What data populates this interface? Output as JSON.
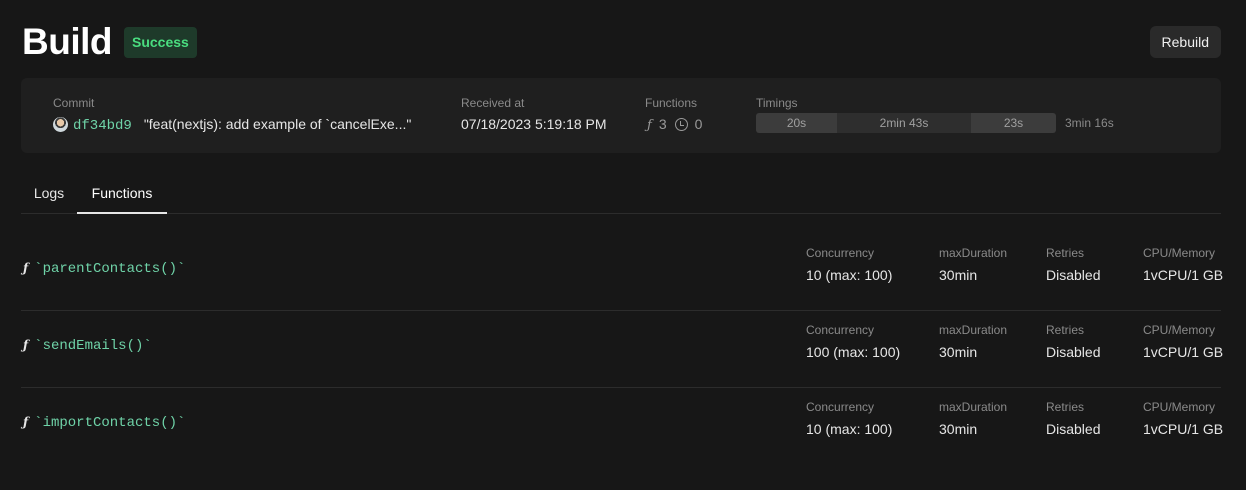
{
  "header": {
    "title": "Build",
    "status": "Success",
    "rebuild_label": "Rebuild"
  },
  "summary": {
    "commit_label": "Commit",
    "commit_hash": "df34bd9",
    "commit_message": "\"feat(nextjs): add example of `cancelExe...\"",
    "received_label": "Received at",
    "received_value": "07/18/2023 5:19:18 PM",
    "functions_label": "Functions",
    "functions_count": "3",
    "scheduled_count": "0",
    "timings_label": "Timings",
    "timings": [
      "20s",
      "2min 43s",
      "23s"
    ],
    "timings_total": "3min 16s"
  },
  "tabs": [
    {
      "label": "Logs",
      "active": false
    },
    {
      "label": "Functions",
      "active": true
    }
  ],
  "functions": [
    {
      "name": "`parentContacts()`",
      "concurrency": "10  (max: 100)",
      "max_duration": "30min",
      "retries": "Disabled",
      "cpu_memory": "1vCPU/1 GB"
    },
    {
      "name": "`sendEmails()`",
      "concurrency": "100  (max: 100)",
      "max_duration": "30min",
      "retries": "Disabled",
      "cpu_memory": "1vCPU/1 GB"
    },
    {
      "name": "`importContacts()`",
      "concurrency": "10  (max: 100)",
      "max_duration": "30min",
      "retries": "Disabled",
      "cpu_memory": "1vCPU/1 GB"
    }
  ],
  "columns": {
    "concurrency": "Concurrency",
    "max_duration": "maxDuration",
    "retries": "Retries",
    "cpu_memory": "CPU/Memory"
  },
  "icons": {
    "function": "function-icon",
    "clock": "clock-icon",
    "avatar": "avatar"
  },
  "colors": {
    "success": "#4ade80",
    "code": "#6fd3a8",
    "background": "#171717"
  }
}
